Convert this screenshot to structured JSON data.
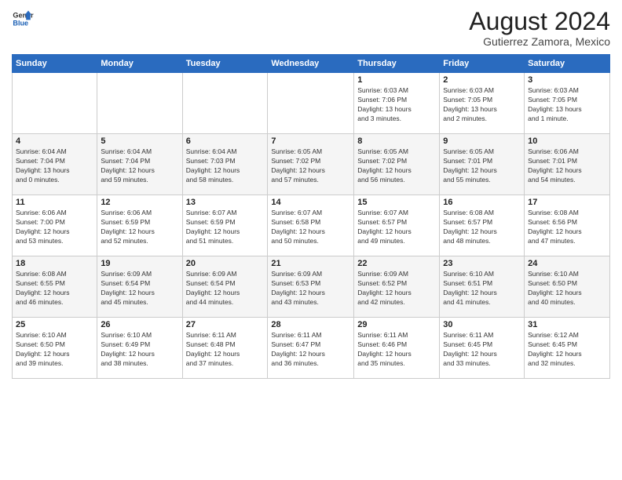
{
  "header": {
    "logo_line1": "General",
    "logo_line2": "Blue",
    "title": "August 2024",
    "subtitle": "Gutierrez Zamora, Mexico"
  },
  "weekdays": [
    "Sunday",
    "Monday",
    "Tuesday",
    "Wednesday",
    "Thursday",
    "Friday",
    "Saturday"
  ],
  "weeks": [
    [
      {
        "day": "",
        "info": ""
      },
      {
        "day": "",
        "info": ""
      },
      {
        "day": "",
        "info": ""
      },
      {
        "day": "",
        "info": ""
      },
      {
        "day": "1",
        "info": "Sunrise: 6:03 AM\nSunset: 7:06 PM\nDaylight: 13 hours\nand 3 minutes."
      },
      {
        "day": "2",
        "info": "Sunrise: 6:03 AM\nSunset: 7:05 PM\nDaylight: 13 hours\nand 2 minutes."
      },
      {
        "day": "3",
        "info": "Sunrise: 6:03 AM\nSunset: 7:05 PM\nDaylight: 13 hours\nand 1 minute."
      }
    ],
    [
      {
        "day": "4",
        "info": "Sunrise: 6:04 AM\nSunset: 7:04 PM\nDaylight: 13 hours\nand 0 minutes."
      },
      {
        "day": "5",
        "info": "Sunrise: 6:04 AM\nSunset: 7:04 PM\nDaylight: 12 hours\nand 59 minutes."
      },
      {
        "day": "6",
        "info": "Sunrise: 6:04 AM\nSunset: 7:03 PM\nDaylight: 12 hours\nand 58 minutes."
      },
      {
        "day": "7",
        "info": "Sunrise: 6:05 AM\nSunset: 7:02 PM\nDaylight: 12 hours\nand 57 minutes."
      },
      {
        "day": "8",
        "info": "Sunrise: 6:05 AM\nSunset: 7:02 PM\nDaylight: 12 hours\nand 56 minutes."
      },
      {
        "day": "9",
        "info": "Sunrise: 6:05 AM\nSunset: 7:01 PM\nDaylight: 12 hours\nand 55 minutes."
      },
      {
        "day": "10",
        "info": "Sunrise: 6:06 AM\nSunset: 7:01 PM\nDaylight: 12 hours\nand 54 minutes."
      }
    ],
    [
      {
        "day": "11",
        "info": "Sunrise: 6:06 AM\nSunset: 7:00 PM\nDaylight: 12 hours\nand 53 minutes."
      },
      {
        "day": "12",
        "info": "Sunrise: 6:06 AM\nSunset: 6:59 PM\nDaylight: 12 hours\nand 52 minutes."
      },
      {
        "day": "13",
        "info": "Sunrise: 6:07 AM\nSunset: 6:59 PM\nDaylight: 12 hours\nand 51 minutes."
      },
      {
        "day": "14",
        "info": "Sunrise: 6:07 AM\nSunset: 6:58 PM\nDaylight: 12 hours\nand 50 minutes."
      },
      {
        "day": "15",
        "info": "Sunrise: 6:07 AM\nSunset: 6:57 PM\nDaylight: 12 hours\nand 49 minutes."
      },
      {
        "day": "16",
        "info": "Sunrise: 6:08 AM\nSunset: 6:57 PM\nDaylight: 12 hours\nand 48 minutes."
      },
      {
        "day": "17",
        "info": "Sunrise: 6:08 AM\nSunset: 6:56 PM\nDaylight: 12 hours\nand 47 minutes."
      }
    ],
    [
      {
        "day": "18",
        "info": "Sunrise: 6:08 AM\nSunset: 6:55 PM\nDaylight: 12 hours\nand 46 minutes."
      },
      {
        "day": "19",
        "info": "Sunrise: 6:09 AM\nSunset: 6:54 PM\nDaylight: 12 hours\nand 45 minutes."
      },
      {
        "day": "20",
        "info": "Sunrise: 6:09 AM\nSunset: 6:54 PM\nDaylight: 12 hours\nand 44 minutes."
      },
      {
        "day": "21",
        "info": "Sunrise: 6:09 AM\nSunset: 6:53 PM\nDaylight: 12 hours\nand 43 minutes."
      },
      {
        "day": "22",
        "info": "Sunrise: 6:09 AM\nSunset: 6:52 PM\nDaylight: 12 hours\nand 42 minutes."
      },
      {
        "day": "23",
        "info": "Sunrise: 6:10 AM\nSunset: 6:51 PM\nDaylight: 12 hours\nand 41 minutes."
      },
      {
        "day": "24",
        "info": "Sunrise: 6:10 AM\nSunset: 6:50 PM\nDaylight: 12 hours\nand 40 minutes."
      }
    ],
    [
      {
        "day": "25",
        "info": "Sunrise: 6:10 AM\nSunset: 6:50 PM\nDaylight: 12 hours\nand 39 minutes."
      },
      {
        "day": "26",
        "info": "Sunrise: 6:10 AM\nSunset: 6:49 PM\nDaylight: 12 hours\nand 38 minutes."
      },
      {
        "day": "27",
        "info": "Sunrise: 6:11 AM\nSunset: 6:48 PM\nDaylight: 12 hours\nand 37 minutes."
      },
      {
        "day": "28",
        "info": "Sunrise: 6:11 AM\nSunset: 6:47 PM\nDaylight: 12 hours\nand 36 minutes."
      },
      {
        "day": "29",
        "info": "Sunrise: 6:11 AM\nSunset: 6:46 PM\nDaylight: 12 hours\nand 35 minutes."
      },
      {
        "day": "30",
        "info": "Sunrise: 6:11 AM\nSunset: 6:45 PM\nDaylight: 12 hours\nand 33 minutes."
      },
      {
        "day": "31",
        "info": "Sunrise: 6:12 AM\nSunset: 6:45 PM\nDaylight: 12 hours\nand 32 minutes."
      }
    ]
  ]
}
